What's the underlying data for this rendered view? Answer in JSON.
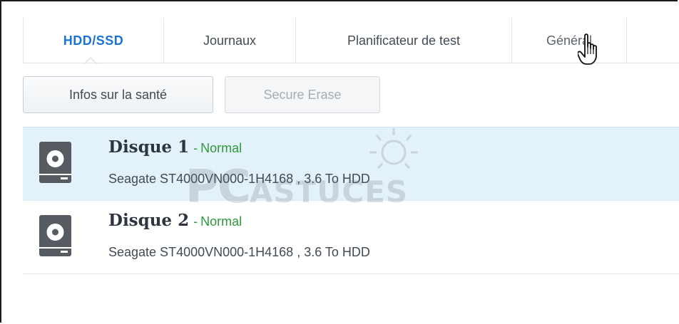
{
  "tabs": [
    {
      "label": "HDD/SSD",
      "active": true
    },
    {
      "label": "Journaux",
      "active": false
    },
    {
      "label": "Planificateur de test",
      "active": false
    },
    {
      "label": "Général",
      "active": false
    }
  ],
  "toolbar": {
    "health_label": "Infos sur la santé",
    "erase_label": "Secure Erase"
  },
  "disks": [
    {
      "name": "Disque 1",
      "separator": "-",
      "status": "Normal",
      "description": "Seagate ST4000VN000-1H4168 , 3.6 To HDD",
      "selected": true,
      "icon": "hard-drive-icon"
    },
    {
      "name": "Disque 2",
      "separator": "-",
      "status": "Normal",
      "description": "Seagate ST4000VN000-1H4168 , 3.6 To HDD",
      "selected": false,
      "icon": "hard-drive-icon"
    }
  ],
  "watermark": {
    "brand": "PC",
    "text": "ASTUCES"
  },
  "colors": {
    "active_tab": "#1a73d9",
    "status_ok": "#2f9a3a",
    "selected_row": "#e3f1fb",
    "icon": "#555b61"
  }
}
